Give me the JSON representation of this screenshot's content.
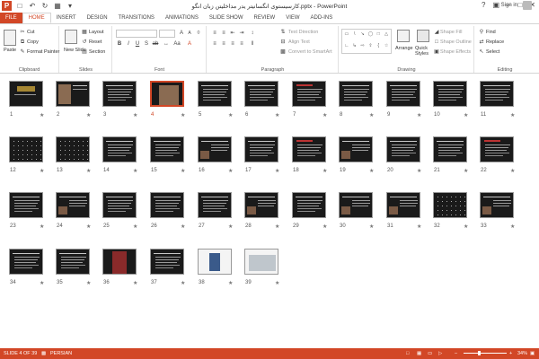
{
  "app": {
    "title": "کارسیستوی انگسانیتر یدر مداخلیتن زبان انگو.pptx - PowerPoint",
    "help": "?",
    "sign_in": "Sign in"
  },
  "qat": [
    "save-icon",
    "undo-icon",
    "redo-icon",
    "slideshow-icon"
  ],
  "tabs": [
    {
      "label": "FILE"
    },
    {
      "label": "HOME"
    },
    {
      "label": "INSERT"
    },
    {
      "label": "DESIGN"
    },
    {
      "label": "TRANSITIONS"
    },
    {
      "label": "ANIMATIONS"
    },
    {
      "label": "SLIDE SHOW"
    },
    {
      "label": "REVIEW"
    },
    {
      "label": "VIEW"
    },
    {
      "label": "ADD-INS"
    }
  ],
  "ribbon": {
    "clipboard": {
      "label": "Clipboard",
      "paste": "Paste",
      "cut": "Cut",
      "copy": "Copy",
      "format_painter": "Format Painter"
    },
    "slides": {
      "label": "Slides",
      "new_slide": "New Slide",
      "layout": "Layout",
      "reset": "Reset",
      "section": "Section"
    },
    "font": {
      "label": "Font",
      "font_name": "",
      "font_size": ""
    },
    "paragraph": {
      "label": "Paragraph",
      "text_direction": "Text Direction",
      "align_text": "Align Text",
      "convert_smartart": "Convert to SmartArt"
    },
    "drawing": {
      "label": "Drawing",
      "arrange": "Arrange",
      "quick_styles": "Quick Styles",
      "shape_fill": "Shape Fill",
      "shape_outline": "Shape Outline",
      "shape_effects": "Shape Effects"
    },
    "editing": {
      "label": "Editing",
      "find": "Find",
      "replace": "Replace",
      "select": "Select"
    }
  },
  "slides": [
    {
      "num": "1",
      "kind": "title",
      "selected": false
    },
    {
      "num": "2",
      "kind": "photo-title",
      "selected": false
    },
    {
      "num": "3",
      "kind": "text",
      "selected": false
    },
    {
      "num": "4",
      "kind": "bigphoto",
      "selected": true
    },
    {
      "num": "5",
      "kind": "text",
      "selected": false
    },
    {
      "num": "6",
      "kind": "text",
      "selected": false
    },
    {
      "num": "7",
      "kind": "text-red",
      "selected": false
    },
    {
      "num": "8",
      "kind": "text",
      "selected": false
    },
    {
      "num": "9",
      "kind": "text",
      "selected": false
    },
    {
      "num": "10",
      "kind": "text",
      "selected": false
    },
    {
      "num": "11",
      "kind": "text",
      "selected": false
    },
    {
      "num": "12",
      "kind": "dots",
      "selected": false
    },
    {
      "num": "13",
      "kind": "dots",
      "selected": false
    },
    {
      "num": "14",
      "kind": "text",
      "selected": false
    },
    {
      "num": "15",
      "kind": "text",
      "selected": false
    },
    {
      "num": "16",
      "kind": "photo",
      "selected": false
    },
    {
      "num": "17",
      "kind": "text",
      "selected": false
    },
    {
      "num": "18",
      "kind": "text-red",
      "selected": false
    },
    {
      "num": "19",
      "kind": "photo",
      "selected": false
    },
    {
      "num": "20",
      "kind": "text",
      "selected": false
    },
    {
      "num": "21",
      "kind": "text",
      "selected": false
    },
    {
      "num": "22",
      "kind": "text-red",
      "selected": false
    },
    {
      "num": "23",
      "kind": "text",
      "selected": false
    },
    {
      "num": "24",
      "kind": "photo",
      "selected": false
    },
    {
      "num": "25",
      "kind": "text",
      "selected": false
    },
    {
      "num": "26",
      "kind": "text",
      "selected": false
    },
    {
      "num": "27",
      "kind": "text",
      "selected": false
    },
    {
      "num": "28",
      "kind": "photo",
      "selected": false
    },
    {
      "num": "29",
      "kind": "text",
      "selected": false
    },
    {
      "num": "30",
      "kind": "photo",
      "selected": false
    },
    {
      "num": "31",
      "kind": "photo",
      "selected": false
    },
    {
      "num": "32",
      "kind": "dots",
      "selected": false
    },
    {
      "num": "33",
      "kind": "photo",
      "selected": false
    },
    {
      "num": "34",
      "kind": "text",
      "selected": false
    },
    {
      "num": "35",
      "kind": "text",
      "selected": false
    },
    {
      "num": "36",
      "kind": "book",
      "selected": false
    },
    {
      "num": "37",
      "kind": "text",
      "selected": false
    },
    {
      "num": "38",
      "kind": "person",
      "selected": false
    },
    {
      "num": "39",
      "kind": "laptop",
      "selected": false
    }
  ],
  "status": {
    "slide_info": "SLIDE 4 OF 39",
    "language": "PERSIAN",
    "zoom": "34%",
    "zoom_level": 0.34
  },
  "colors": {
    "accent": "#d24726",
    "slide_bg": "#1a1a1a"
  }
}
